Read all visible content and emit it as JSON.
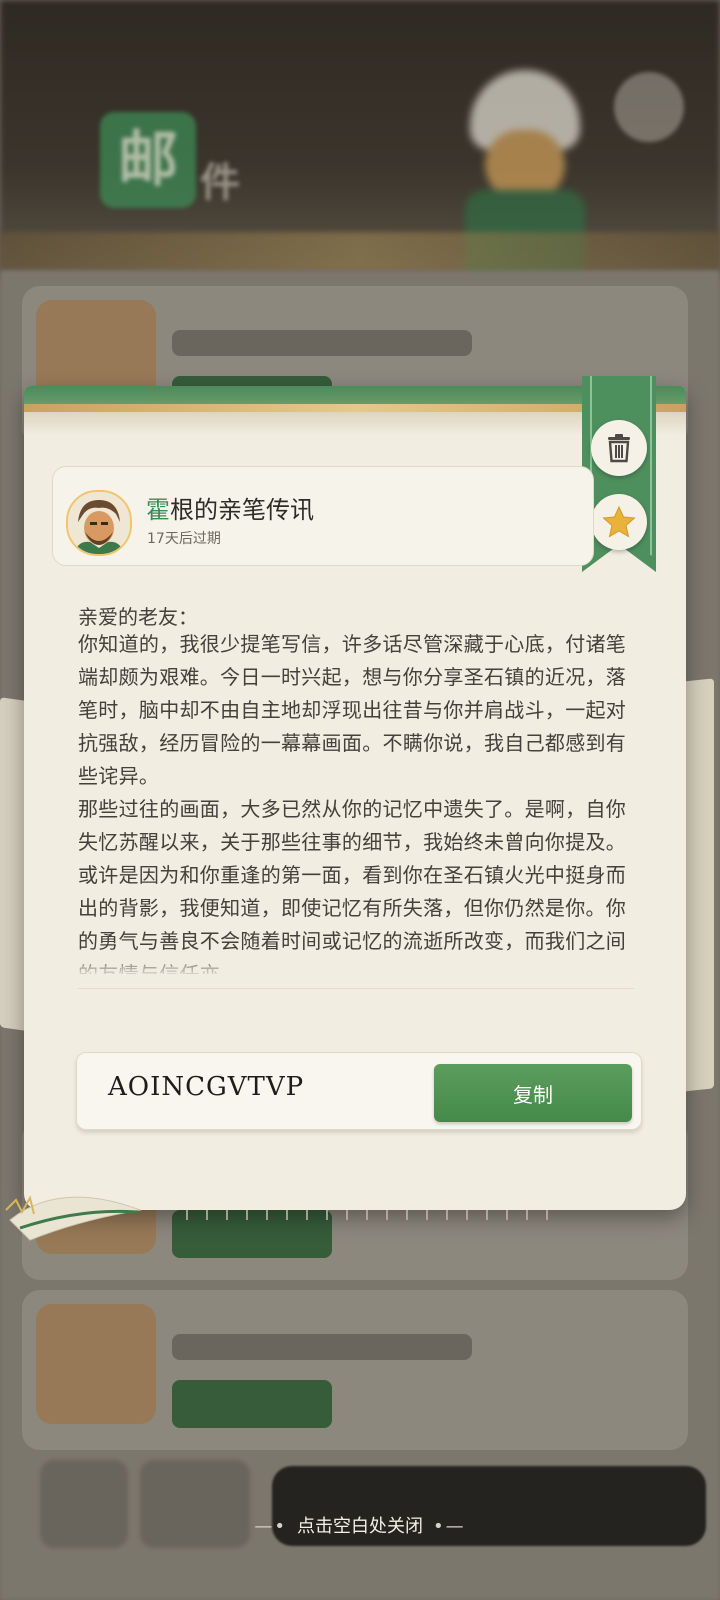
{
  "letter": {
    "title_accent": "霍",
    "title_rest": "根的亲笔传讯",
    "expire_text": "17天后过期",
    "greeting": "亲爱的老友：",
    "paragraphs": [
      "你知道的，我很少提笔写信，许多话尽管深藏于心底，付诸笔端却颇为艰难。今日一时兴起，想与你分享圣石镇的近况，落笔时，脑中却不由自主地却浮现出往昔与你并肩战斗，一起对抗强敌，经历冒险的一幕幕画面。不瞒你说，我自己都感到有些诧异。",
      "那些过往的画面，大多已然从你的记忆中遗失了。是啊，自你失忆苏醒以来，关于那些往事的细节，我始终未曾向你提及。或许是因为和你重逢的第一面，看到你在圣石镇火光中挺身而出的背影，我便知道，即使记忆有所失落，但你仍然是你。你的勇气与善良不会随着时间或记忆的流逝所改变，而我们之间的友情与信任亦"
    ],
    "code": "AOINCGVTVP",
    "copy_label": "复制"
  },
  "close_hint": "点击空白处关闭",
  "icons": {
    "delete": "trash-icon",
    "favorite": "star-icon"
  },
  "colors": {
    "accent_green": "#3e8a55",
    "paper": "#f1ede1",
    "star": "#e9b23a"
  }
}
